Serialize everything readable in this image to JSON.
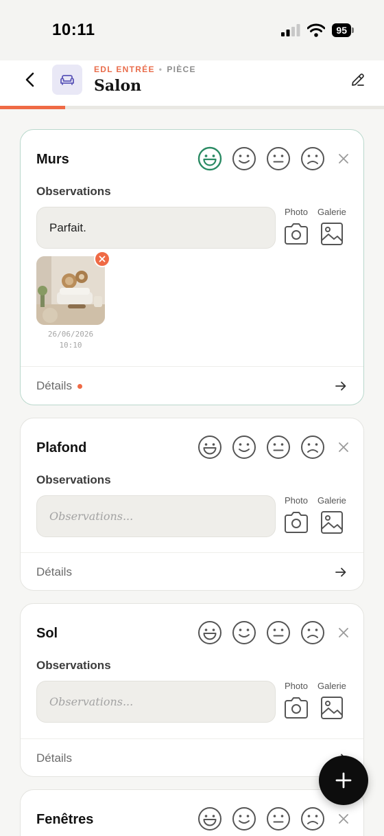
{
  "status_bar": {
    "time": "10:11",
    "battery": "95"
  },
  "header": {
    "crumb_primary": "EDL ENTRÉE",
    "crumb_separator": "•",
    "crumb_secondary": "PIÈCE",
    "title": "Salon",
    "progress": 0.17
  },
  "colors": {
    "accent": "#ef6a45",
    "selected_rating": "#2a8a63",
    "room_badge": "#e9e8f6"
  },
  "cards": [
    {
      "title": "Murs",
      "observations_label": "Observations",
      "observations_value": "Parfait.",
      "observations_placeholder": "Observations...",
      "photo_label": "Photo",
      "gallery_label": "Galerie",
      "selected_rating": "very-good",
      "attachments": [
        {
          "date": "26/06/2026",
          "time": "10:10"
        }
      ],
      "details_label": "Détails",
      "details_flag": true
    },
    {
      "title": "Plafond",
      "observations_label": "Observations",
      "observations_value": "",
      "observations_placeholder": "Observations...",
      "photo_label": "Photo",
      "gallery_label": "Galerie",
      "selected_rating": null,
      "details_label": "Détails",
      "details_flag": false
    },
    {
      "title": "Sol",
      "observations_label": "Observations",
      "observations_value": "",
      "observations_placeholder": "Observations...",
      "photo_label": "Photo",
      "gallery_label": "Galerie",
      "selected_rating": null,
      "details_label": "Détails",
      "details_flag": false
    },
    {
      "title": "Fenêtres",
      "selected_rating": null
    }
  ],
  "icons": {
    "ratings": [
      "very-good-face-icon",
      "good-face-icon",
      "neutral-face-icon",
      "bad-face-icon"
    ],
    "add": "plus-icon"
  }
}
